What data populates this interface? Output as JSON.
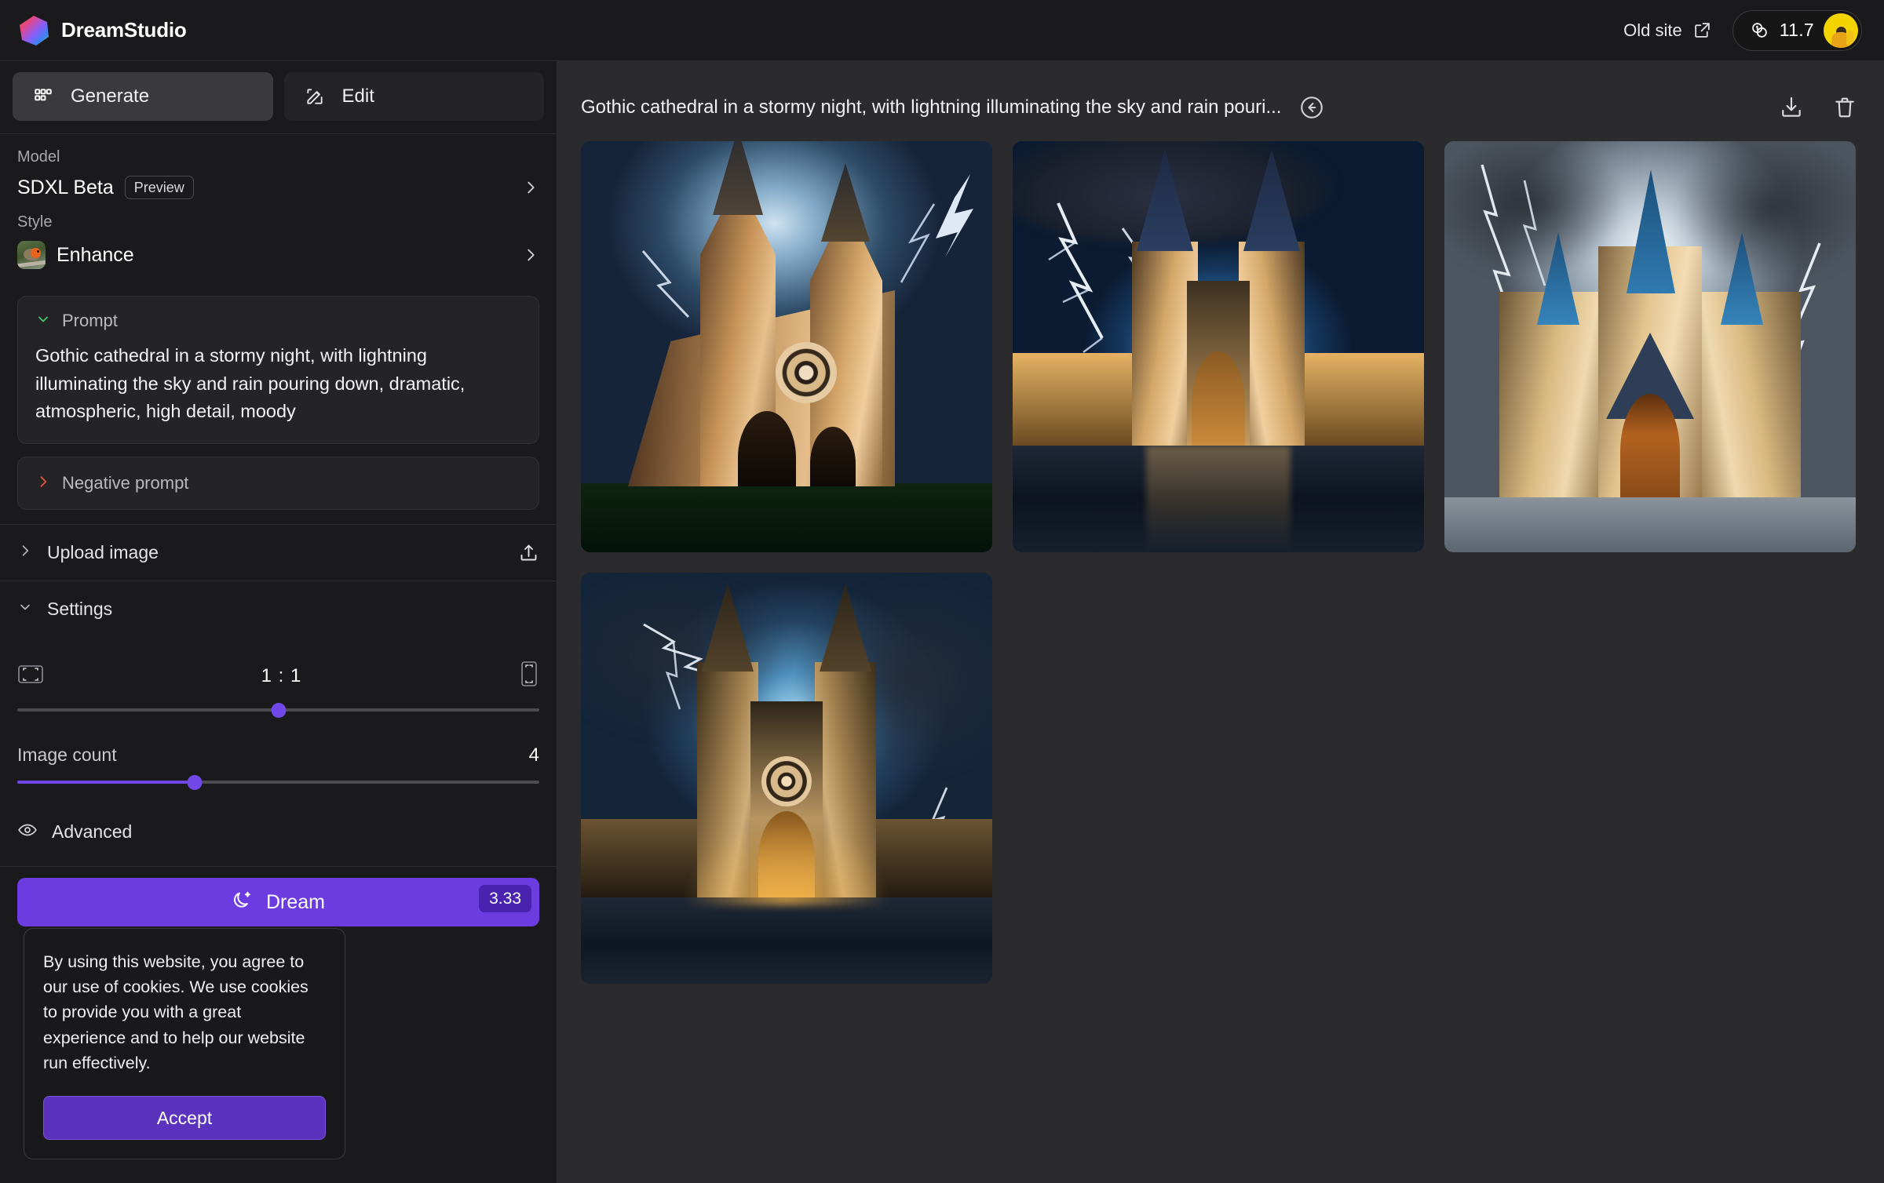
{
  "app": {
    "brand": "DreamStudio",
    "logo_icon": "hexagon-gradient-logo"
  },
  "topbar": {
    "old_site_label": "Old site",
    "old_site_icon": "external-link-icon",
    "credits": "11.7",
    "credits_icon": "coins-icon",
    "avatar_icon": "user-avatar"
  },
  "tabs": [
    {
      "label": "Generate",
      "icon": "grid-icon",
      "active": true
    },
    {
      "label": "Edit",
      "icon": "pencil-square-icon",
      "active": false
    }
  ],
  "model": {
    "label": "Model",
    "value": "SDXL Beta",
    "badge": "Preview",
    "chevron_icon": "chevron-right-icon"
  },
  "style": {
    "label": "Style",
    "value": "Enhance",
    "thumbnail_icon": "robin-bird-thumbnail",
    "chevron_icon": "chevron-right-icon"
  },
  "prompt": {
    "label": "Prompt",
    "chevron_icon": "chevron-down-icon",
    "text": "Gothic cathedral in a stormy night, with lightning illuminating the sky and rain pouring down, dramatic, atmospheric, high detail, moody"
  },
  "negative_prompt": {
    "label": "Negative prompt",
    "chevron_icon": "chevron-right-icon"
  },
  "upload_image": {
    "label": "Upload image",
    "chevron_icon": "chevron-right-icon",
    "action_icon": "upload-icon"
  },
  "settings": {
    "label": "Settings",
    "chevron_icon": "chevron-down-icon",
    "aspect_ratio": {
      "value": "1 : 1",
      "left_icon": "landscape-frame-icon",
      "right_icon": "portrait-frame-icon",
      "slider_percent": 50
    },
    "image_count": {
      "label": "Image count",
      "value": "4",
      "slider_percent": 34
    },
    "advanced": {
      "label": "Advanced",
      "icon": "eye-icon"
    }
  },
  "dream": {
    "label": "Dream",
    "icon": "moon-sparkle-icon",
    "cost": "3.33"
  },
  "cookie_banner": {
    "text": "By using this website, you agree to our use of cookies. We use cookies to provide you with a great experience and to help our website run effectively.",
    "accept_label": "Accept"
  },
  "main": {
    "title": "Gothic cathedral in a stormy night, with lightning illuminating the sky and rain pouri...",
    "back_icon": "back-arrow-circle-icon",
    "download_icon": "download-icon",
    "delete_icon": "trash-icon",
    "results": [
      {
        "name": "generated-image-1",
        "alt": "Gothic cathedral at night, dark navy sky, white lightning, warm uplit sandstone facade, grass foreground"
      },
      {
        "name": "generated-image-2",
        "alt": "Symmetrical twin-spired cathedral, bright blue glow, forked lightning upper left, wet reflective plaza"
      },
      {
        "name": "generated-image-3",
        "alt": "Three blue-roofed spires, golden stone facade, grey stormy sky with lightning both sides"
      },
      {
        "name": "generated-image-4",
        "alt": "Twin tall spires with rose window, golden uplighting, dark blue storm clouds and lightning"
      }
    ]
  },
  "colors": {
    "accent_purple": "#6c3ce0",
    "slider_purple": "#7048e8",
    "sidebar_bg": "#1a1a1c",
    "main_bg": "#2b2b2e",
    "cost_badge": "#4a22b0"
  }
}
